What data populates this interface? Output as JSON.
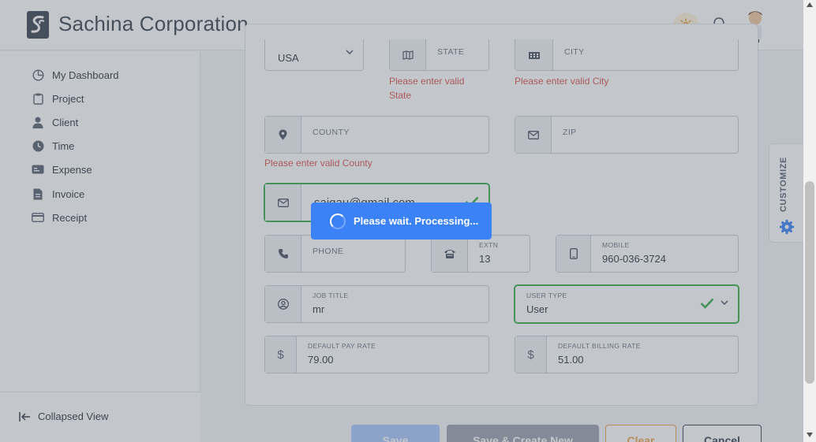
{
  "header": {
    "brand": "Sachina Corporation",
    "icons": {
      "theme": "sun-icon",
      "notifications": "bell-icon",
      "avatar": "user-avatar"
    }
  },
  "sidebar": {
    "items": [
      {
        "label": "My Dashboard",
        "icon": "dashboard-icon"
      },
      {
        "label": "Project",
        "icon": "clipboard-icon"
      },
      {
        "label": "Client",
        "icon": "person-icon"
      },
      {
        "label": "Time",
        "icon": "clock-icon"
      },
      {
        "label": "Expense",
        "icon": "money-icon"
      },
      {
        "label": "Invoice",
        "icon": "invoice-icon"
      },
      {
        "label": "Receipt",
        "icon": "card-icon"
      }
    ],
    "collapse_label": "Collapsed View"
  },
  "form": {
    "country": {
      "value": "USA"
    },
    "state": {
      "label": "STATE",
      "error": "Please enter valid State"
    },
    "city": {
      "label": "CITY",
      "error": "Please enter valid City"
    },
    "county": {
      "label": "COUNTY",
      "error": "Please enter valid County"
    },
    "zip": {
      "label": "ZIP"
    },
    "email": {
      "value": "saigau@gmail.com"
    },
    "phone": {
      "label": "PHONE"
    },
    "extn": {
      "label": "EXTN",
      "value": "13"
    },
    "mobile": {
      "label": "MOBILE",
      "value": "960-036-3724"
    },
    "job_title": {
      "label": "JOB TITLE",
      "value": "mr"
    },
    "user_type": {
      "label": "USER TYPE",
      "value": "User"
    },
    "pay_rate": {
      "label": "DEFAULT PAY RATE",
      "value": "79.00",
      "symbol": "$"
    },
    "billing_rate": {
      "label": "DEFAULT BILLING RATE",
      "value": "51.00",
      "symbol": "$"
    }
  },
  "actions": {
    "save": "Save",
    "save_create": "Save & Create New",
    "clear": "Clear",
    "cancel": "Cancel"
  },
  "customize": {
    "label": "CUSTOMIZE"
  },
  "loading": {
    "message": "Please wait. Processing..."
  },
  "colors": {
    "primary": "#3b82f6",
    "valid": "#3cae4b",
    "error": "#d9534f",
    "clear": "#f0a24b"
  }
}
